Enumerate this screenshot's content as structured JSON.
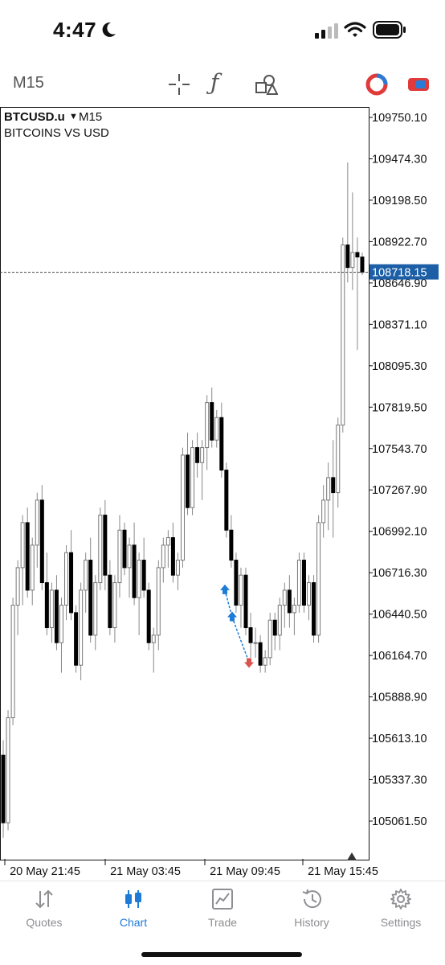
{
  "status_bar": {
    "time": "4:47"
  },
  "toolbar": {
    "timeframe": "M15",
    "icons": [
      "crosshair-icon",
      "function-icon",
      "objects-icon",
      "color-icon",
      "trade-icon"
    ]
  },
  "chart": {
    "symbol": "BTCUSD.u",
    "dropdown_marker": "▼",
    "timeframe": "M15",
    "description": "BITCOINS VS USD",
    "current_price_label": "108718.15",
    "price_labels": [
      "109750.10",
      "109474.30",
      "109198.50",
      "108922.70",
      "108646.90",
      "108371.10",
      "108095.30",
      "107819.50",
      "107543.70",
      "107267.90",
      "106992.10",
      "106716.30",
      "106440.50",
      "106164.70",
      "105888.90",
      "105613.10",
      "105337.30",
      "105061.50"
    ],
    "time_labels": [
      "20 May 21:45",
      "21 May 03:45",
      "21 May 09:45",
      "21 May 15:45"
    ],
    "colors": {
      "bull": "#ffffff",
      "bear": "#000000",
      "wick": "#888888",
      "price_tag": "#1c5fa6",
      "buy_arrow": "#1e7bd6",
      "sell_arrow": "#d9534f"
    }
  },
  "chart_data": {
    "type": "candlestick",
    "title": "BITCOINS VS USD",
    "symbol": "BTCUSD.u",
    "timeframe": "M15",
    "ylim": [
      104900,
      109900
    ],
    "current_price": 108718.15,
    "candles": [
      {
        "o": 105500,
        "h": 105600,
        "l": 104950,
        "c": 105050
      },
      {
        "o": 105050,
        "h": 105800,
        "l": 105000,
        "c": 105750
      },
      {
        "o": 105750,
        "h": 106550,
        "l": 105700,
        "c": 106500
      },
      {
        "o": 106500,
        "h": 106800,
        "l": 106300,
        "c": 106750
      },
      {
        "o": 106750,
        "h": 107100,
        "l": 106500,
        "c": 107050
      },
      {
        "o": 107050,
        "h": 107150,
        "l": 106550,
        "c": 106600
      },
      {
        "o": 106600,
        "h": 106950,
        "l": 106500,
        "c": 106900
      },
      {
        "o": 106900,
        "h": 107250,
        "l": 106750,
        "c": 107200
      },
      {
        "o": 107200,
        "h": 107300,
        "l": 106600,
        "c": 106650
      },
      {
        "o": 106650,
        "h": 106850,
        "l": 106300,
        "c": 106350
      },
      {
        "o": 106350,
        "h": 106650,
        "l": 106250,
        "c": 106600
      },
      {
        "o": 106600,
        "h": 106700,
        "l": 106200,
        "c": 106250
      },
      {
        "o": 106250,
        "h": 106550,
        "l": 106050,
        "c": 106500
      },
      {
        "o": 106500,
        "h": 106900,
        "l": 106400,
        "c": 106850
      },
      {
        "o": 106850,
        "h": 107000,
        "l": 106400,
        "c": 106450
      },
      {
        "o": 106450,
        "h": 106500,
        "l": 106050,
        "c": 106100
      },
      {
        "o": 106100,
        "h": 106650,
        "l": 106000,
        "c": 106600
      },
      {
        "o": 106600,
        "h": 106850,
        "l": 106450,
        "c": 106800
      },
      {
        "o": 106800,
        "h": 106950,
        "l": 106250,
        "c": 106300
      },
      {
        "o": 106300,
        "h": 106700,
        "l": 106200,
        "c": 106650
      },
      {
        "o": 106650,
        "h": 107150,
        "l": 106600,
        "c": 107100
      },
      {
        "o": 107100,
        "h": 107200,
        "l": 106600,
        "c": 106700
      },
      {
        "o": 106700,
        "h": 106800,
        "l": 106300,
        "c": 106350
      },
      {
        "o": 106350,
        "h": 106700,
        "l": 106250,
        "c": 106650
      },
      {
        "o": 106650,
        "h": 107100,
        "l": 106550,
        "c": 107000
      },
      {
        "o": 107000,
        "h": 107050,
        "l": 106700,
        "c": 106750
      },
      {
        "o": 106750,
        "h": 106950,
        "l": 106550,
        "c": 106900
      },
      {
        "o": 106900,
        "h": 107050,
        "l": 106500,
        "c": 106550
      },
      {
        "o": 106550,
        "h": 106850,
        "l": 106300,
        "c": 106800
      },
      {
        "o": 106800,
        "h": 106950,
        "l": 106550,
        "c": 106600
      },
      {
        "o": 106600,
        "h": 106650,
        "l": 106200,
        "c": 106250
      },
      {
        "o": 106250,
        "h": 106350,
        "l": 106050,
        "c": 106300
      },
      {
        "o": 106300,
        "h": 106800,
        "l": 106200,
        "c": 106750
      },
      {
        "o": 106750,
        "h": 106950,
        "l": 106650,
        "c": 106900
      },
      {
        "o": 106900,
        "h": 107000,
        "l": 106750,
        "c": 106950
      },
      {
        "o": 106950,
        "h": 107050,
        "l": 106650,
        "c": 106700
      },
      {
        "o": 106700,
        "h": 106850,
        "l": 106600,
        "c": 106800
      },
      {
        "o": 106800,
        "h": 107550,
        "l": 106750,
        "c": 107500
      },
      {
        "o": 107500,
        "h": 107650,
        "l": 107100,
        "c": 107150
      },
      {
        "o": 107150,
        "h": 107600,
        "l": 107100,
        "c": 107550
      },
      {
        "o": 107550,
        "h": 107650,
        "l": 107350,
        "c": 107450
      },
      {
        "o": 107450,
        "h": 107600,
        "l": 107200,
        "c": 107550
      },
      {
        "o": 107550,
        "h": 107900,
        "l": 107400,
        "c": 107850
      },
      {
        "o": 107850,
        "h": 107950,
        "l": 107550,
        "c": 107600
      },
      {
        "o": 107600,
        "h": 107800,
        "l": 107550,
        "c": 107750
      },
      {
        "o": 107750,
        "h": 107850,
        "l": 107350,
        "c": 107400
      },
      {
        "o": 107400,
        "h": 107450,
        "l": 106950,
        "c": 107000
      },
      {
        "o": 107000,
        "h": 107100,
        "l": 106750,
        "c": 106800
      },
      {
        "o": 106800,
        "h": 106850,
        "l": 106450,
        "c": 106500
      },
      {
        "o": 106500,
        "h": 106750,
        "l": 106350,
        "c": 106700
      },
      {
        "o": 106700,
        "h": 106750,
        "l": 106300,
        "c": 106350
      },
      {
        "o": 106350,
        "h": 106450,
        "l": 106150,
        "c": 106250
      },
      {
        "o": 106250,
        "h": 106350,
        "l": 106150,
        "c": 106250
      },
      {
        "o": 106250,
        "h": 106300,
        "l": 106050,
        "c": 106100
      },
      {
        "o": 106100,
        "h": 106200,
        "l": 106050,
        "c": 106150
      },
      {
        "o": 106150,
        "h": 106450,
        "l": 106100,
        "c": 106400
      },
      {
        "o": 106400,
        "h": 106450,
        "l": 106200,
        "c": 106300
      },
      {
        "o": 106300,
        "h": 106550,
        "l": 106200,
        "c": 106500
      },
      {
        "o": 106500,
        "h": 106650,
        "l": 106350,
        "c": 106600
      },
      {
        "o": 106600,
        "h": 106700,
        "l": 106350,
        "c": 106450
      },
      {
        "o": 106450,
        "h": 106550,
        "l": 106300,
        "c": 106500
      },
      {
        "o": 106500,
        "h": 106850,
        "l": 106450,
        "c": 106800
      },
      {
        "o": 106800,
        "h": 106850,
        "l": 106450,
        "c": 106500
      },
      {
        "o": 106500,
        "h": 106700,
        "l": 106400,
        "c": 106650
      },
      {
        "o": 106650,
        "h": 106700,
        "l": 106250,
        "c": 106300
      },
      {
        "o": 106300,
        "h": 107100,
        "l": 106250,
        "c": 107050
      },
      {
        "o": 107050,
        "h": 107300,
        "l": 106950,
        "c": 107200
      },
      {
        "o": 107200,
        "h": 107450,
        "l": 107000,
        "c": 107350
      },
      {
        "o": 107350,
        "h": 107600,
        "l": 106950,
        "c": 107250
      },
      {
        "o": 107250,
        "h": 107750,
        "l": 107150,
        "c": 107700
      },
      {
        "o": 107700,
        "h": 108950,
        "l": 107650,
        "c": 108900
      },
      {
        "o": 108900,
        "h": 109450,
        "l": 108650,
        "c": 108750
      },
      {
        "o": 108750,
        "h": 109250,
        "l": 108600,
        "c": 108850
      },
      {
        "o": 108850,
        "h": 108950,
        "l": 108200,
        "c": 108820
      },
      {
        "o": 108820,
        "h": 108850,
        "l": 108700,
        "c": 108718
      }
    ],
    "trade_markers": [
      {
        "type": "buy",
        "price": 106600
      },
      {
        "type": "buy",
        "price": 106420
      },
      {
        "type": "sell",
        "price": 106120
      }
    ],
    "price_ticks": [
      109750.1,
      109474.3,
      109198.5,
      108922.7,
      108646.9,
      108371.1,
      108095.3,
      107819.5,
      107543.7,
      107267.9,
      106992.1,
      106716.3,
      106440.5,
      106164.7,
      105888.9,
      105613.1,
      105337.3,
      105061.5
    ],
    "time_ticks": [
      "20 May 21:45",
      "21 May 03:45",
      "21 May 09:45",
      "21 May 15:45"
    ],
    "grid": false
  },
  "tabs": [
    {
      "label": "Quotes",
      "icon": "quotes-icon",
      "active": false
    },
    {
      "label": "Chart",
      "icon": "chart-icon",
      "active": true
    },
    {
      "label": "Trade",
      "icon": "trade-tab-icon",
      "active": false
    },
    {
      "label": "History",
      "icon": "history-icon",
      "active": false
    },
    {
      "label": "Settings",
      "icon": "settings-icon",
      "active": false
    }
  ]
}
